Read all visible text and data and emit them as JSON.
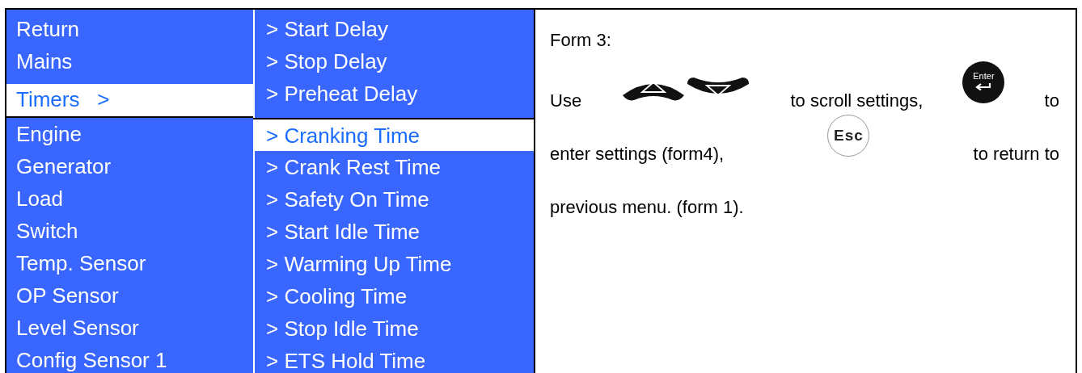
{
  "main_menu": {
    "items": [
      {
        "label": "Return",
        "selected": false
      },
      {
        "label": "Mains",
        "selected": false
      },
      {
        "label": "Timers   >",
        "selected": true
      },
      {
        "label": "Engine",
        "selected": false
      },
      {
        "label": "Generator",
        "selected": false
      },
      {
        "label": "Load",
        "selected": false
      },
      {
        "label": "Switch",
        "selected": false
      },
      {
        "label": "Temp. Sensor",
        "selected": false
      },
      {
        "label": "OP Sensor",
        "selected": false
      },
      {
        "label": "Level Sensor",
        "selected": false
      },
      {
        "label": "Config Sensor 1",
        "selected": false
      }
    ]
  },
  "timers_menu": {
    "items": [
      {
        "label": "> Start Delay",
        "selected": false
      },
      {
        "label": "> Stop Delay",
        "selected": false
      },
      {
        "label": "> Preheat Delay",
        "selected": false
      },
      {
        "label": "> Cranking Time",
        "selected": true
      },
      {
        "label": "> Crank Rest Time",
        "selected": false
      },
      {
        "label": "> Safety On Time",
        "selected": false
      },
      {
        "label": "> Start Idle Time",
        "selected": false
      },
      {
        "label": "> Warming Up Time",
        "selected": false
      },
      {
        "label": "> Cooling Time",
        "selected": false
      },
      {
        "label": "> Stop Idle Time",
        "selected": false
      },
      {
        "label": "> ETS Hold Time",
        "selected": false
      }
    ]
  },
  "description": {
    "title": "Form 3:",
    "lines": [
      [
        {
          "kind": "text",
          "text": "Use"
        },
        {
          "kind": "updown"
        },
        {
          "kind": "text",
          "text": "to scroll settings,"
        },
        {
          "kind": "enter",
          "label": "Enter"
        },
        {
          "kind": "text",
          "text": "to"
        }
      ],
      [
        {
          "kind": "text",
          "text": "enter settings (form4),"
        },
        {
          "kind": "esc",
          "label": "Esc"
        },
        {
          "kind": "text",
          "text": "to return to"
        }
      ],
      [
        {
          "kind": "text",
          "text": "previous menu. (form 1)."
        }
      ]
    ]
  }
}
